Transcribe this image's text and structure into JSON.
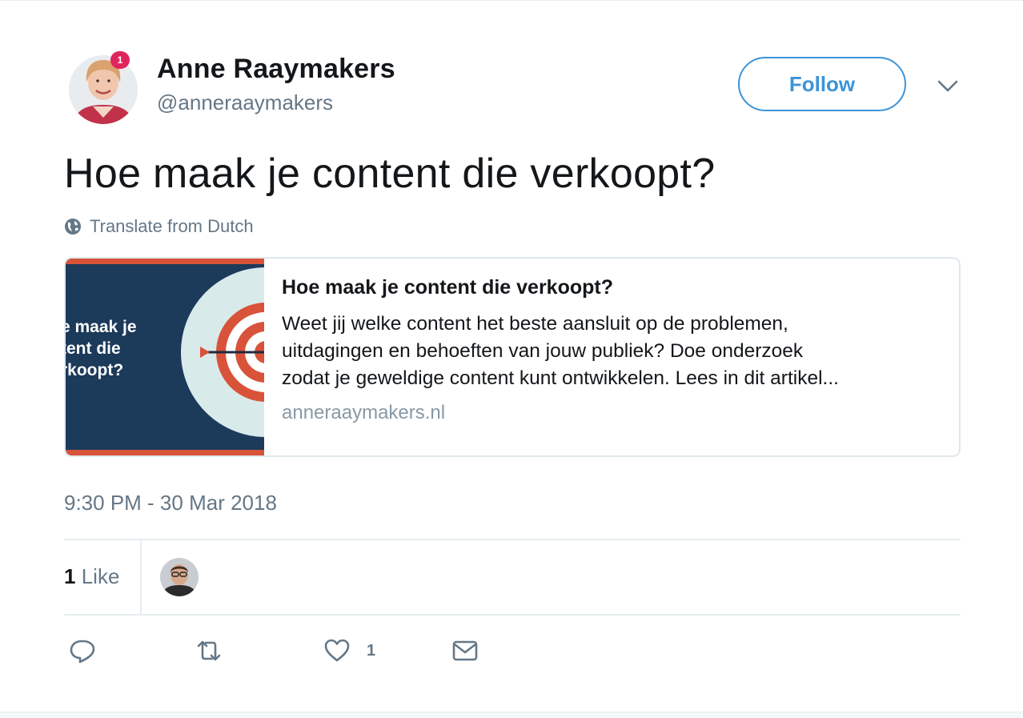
{
  "user": {
    "display_name": "Anne Raaymakers",
    "handle": "@anneraaymakers",
    "notification_count": "1"
  },
  "header": {
    "follow_label": "Follow"
  },
  "tweet": {
    "text": "Hoe maak je content die verkoopt?",
    "translate_label": "Translate from Dutch",
    "timestamp": "9:30 PM - 30 Mar 2018"
  },
  "card": {
    "image_text": [
      "e maak je",
      "tent die",
      "rkoopt?"
    ],
    "title": "Hoe maak je content die verkoopt?",
    "description_lines": [
      "Weet jij welke content het beste aansluit op de problemen,",
      "uitdagingen en behoeften van jouw publiek? Doe onderzoek",
      "zodat je geweldige content kunt ontwikkelen. Lees in dit artikel..."
    ],
    "domain": "anneraaymakers.nl"
  },
  "stats": {
    "like_count": "1",
    "like_label": "Like"
  },
  "actions": {
    "reply_icon": "reply-icon",
    "retweet_icon": "retweet-icon",
    "like_icon": "heart-icon",
    "like_count": "1",
    "dm_icon": "envelope-icon"
  },
  "colors": {
    "accent": "#3b94d9",
    "muted": "#657786",
    "badge": "#e0245e",
    "card_navy": "#1c3a5a",
    "card_red": "#d8533a"
  }
}
